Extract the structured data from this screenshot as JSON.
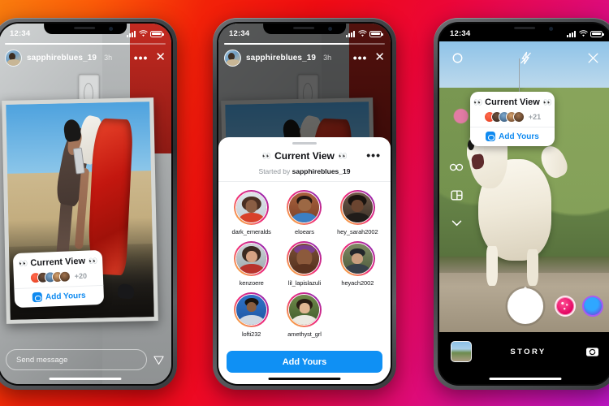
{
  "background": {
    "gradient_colors": [
      "#f97c0e",
      "#f22208",
      "#ec0636",
      "#c016c8"
    ],
    "description": "orange to red to magenta diagonal gradient"
  },
  "status_bar": {
    "time": "12:34",
    "signal": "signal-bars",
    "wifi": "wifi-icon",
    "battery": "battery-icon"
  },
  "phone1": {
    "story": {
      "username": "sapphireblues_19",
      "timestamp": "3h",
      "more_label": "•••",
      "close_label": "✕"
    },
    "sticker": {
      "eyes_left": "👀",
      "eyes_right": "👀",
      "title": "Current View",
      "count": "+20",
      "add_label": "Add Yours"
    },
    "reply": {
      "placeholder": "Send message",
      "send_icon": "send-icon"
    }
  },
  "phone2": {
    "story": {
      "username": "sapphireblues_19",
      "timestamp": "3h",
      "more_label": "•••",
      "close_label": "✕"
    },
    "sheet": {
      "eyes_left": "👀",
      "eyes_right": "👀",
      "title": "Current View",
      "more_label": "•••",
      "subtitle_prefix": "Started by ",
      "subtitle_user": "sapphireblues_19",
      "button_label": "Add Yours",
      "participants": [
        {
          "username": "dark_emeralds"
        },
        {
          "username": "eloears"
        },
        {
          "username": "hey_sarah2002"
        },
        {
          "username": "kenzoere"
        },
        {
          "username": "lil_lapislazuli"
        },
        {
          "username": "heyach2002"
        },
        {
          "username": "lofti232"
        },
        {
          "username": "amethyst_grl"
        }
      ]
    }
  },
  "phone3": {
    "camera": {
      "settings_icon": "settings-icon",
      "flash_off_icon": "flash-off-icon",
      "close_icon": "close-icon",
      "tools": [
        "boomerang-icon",
        "layout-icon",
        "chevron-down-icon"
      ],
      "mode_label": "STORY",
      "shutter": "shutter-button",
      "gallery": "gallery-thumbnail",
      "flip_camera": "flip-camera-icon",
      "effects": [
        "effect-pink",
        "effect-blue"
      ]
    },
    "sticker": {
      "eyes_left": "👀",
      "eyes_right": "👀",
      "title": "Current View",
      "count": "+21",
      "add_label": "Add Yours"
    }
  },
  "colors": {
    "accent_blue": "#0f90f4",
    "link_blue": "#0f8af0"
  }
}
